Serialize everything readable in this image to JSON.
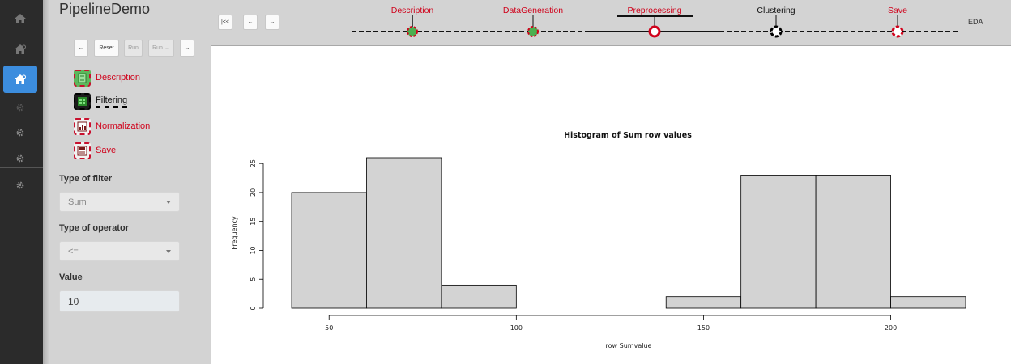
{
  "app": {
    "title": "PipelineDemo"
  },
  "controls": {
    "back": "←",
    "reset": "Reset",
    "run": "Run",
    "run_next": "Run →",
    "forward": "→"
  },
  "steps": [
    {
      "label": "Description",
      "icon": "document-icon",
      "state": "done"
    },
    {
      "label": "Filtering",
      "icon": "filter-matrix-icon",
      "state": "current"
    },
    {
      "label": "Normalization",
      "icon": "normalization-chart-icon",
      "state": "todo"
    },
    {
      "label": "Save",
      "icon": "save-document-icon",
      "state": "todo"
    }
  ],
  "form": {
    "filter_type_label": "Type of filter",
    "filter_type_value": "Sum",
    "operator_label": "Type of operator",
    "operator_value": "<=",
    "value_label": "Value",
    "value_value": "10"
  },
  "pipeline_nav": {
    "first": "|<<",
    "prev": "←",
    "next": "→"
  },
  "pipeline": {
    "stages": [
      {
        "label": "Description",
        "status": "done"
      },
      {
        "label": "DataGeneration",
        "status": "done"
      },
      {
        "label": "Preprocessing",
        "status": "current"
      },
      {
        "label": "Clustering",
        "status": "pending-next"
      },
      {
        "label": "Save",
        "status": "pending"
      }
    ],
    "end_label": "EDA"
  },
  "colors": {
    "accent_red": "#d0021b",
    "done_green": "#4caf50",
    "active_blue": "#3c8dde"
  },
  "chart_data": {
    "type": "bar",
    "title": "Histogram of Sum row values",
    "xlabel": "row Sumvalue",
    "ylabel": "Frequency",
    "bins": [
      [
        40,
        60
      ],
      [
        60,
        80
      ],
      [
        80,
        100
      ],
      [
        100,
        120
      ],
      [
        120,
        140
      ],
      [
        140,
        160
      ],
      [
        160,
        180
      ],
      [
        180,
        200
      ],
      [
        200,
        220
      ]
    ],
    "values": [
      20,
      26,
      4,
      0,
      0,
      2,
      23,
      23,
      2
    ],
    "xticks": [
      50,
      100,
      150,
      200
    ],
    "yticks": [
      0,
      5,
      10,
      15,
      20,
      25
    ],
    "xlim": [
      40,
      220
    ],
    "ylim": [
      0,
      26
    ]
  }
}
